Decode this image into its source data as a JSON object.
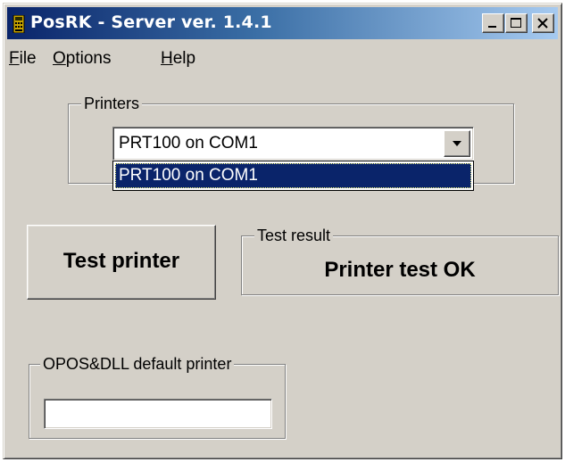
{
  "window": {
    "title": "PosRK - Server ver. 1.4.1",
    "app_icon": "pos-terminal-icon",
    "controls": [
      "minimize-icon",
      "maximize-icon",
      "close-icon"
    ]
  },
  "menubar": {
    "file": {
      "accel": "F",
      "rest": "ile"
    },
    "options": {
      "accel": "O",
      "rest": "ptions"
    },
    "help": {
      "accel": "H",
      "rest": "elp"
    }
  },
  "printers": {
    "group_label": "Printers",
    "selected": "PRT100 on COM1",
    "options": [
      "PRT100 on COM1"
    ],
    "dropdown_open": true
  },
  "test": {
    "button_label": "Test printer",
    "result_group_label": "Test result",
    "result_value": "Printer test OK"
  },
  "opos": {
    "group_label": "OPOS&DLL default printer",
    "value": ""
  },
  "colors": {
    "title_gradient_start": "#0a246a",
    "title_gradient_end": "#a6caf0",
    "face": "#d4d0c8",
    "selection": "#0a246a"
  }
}
